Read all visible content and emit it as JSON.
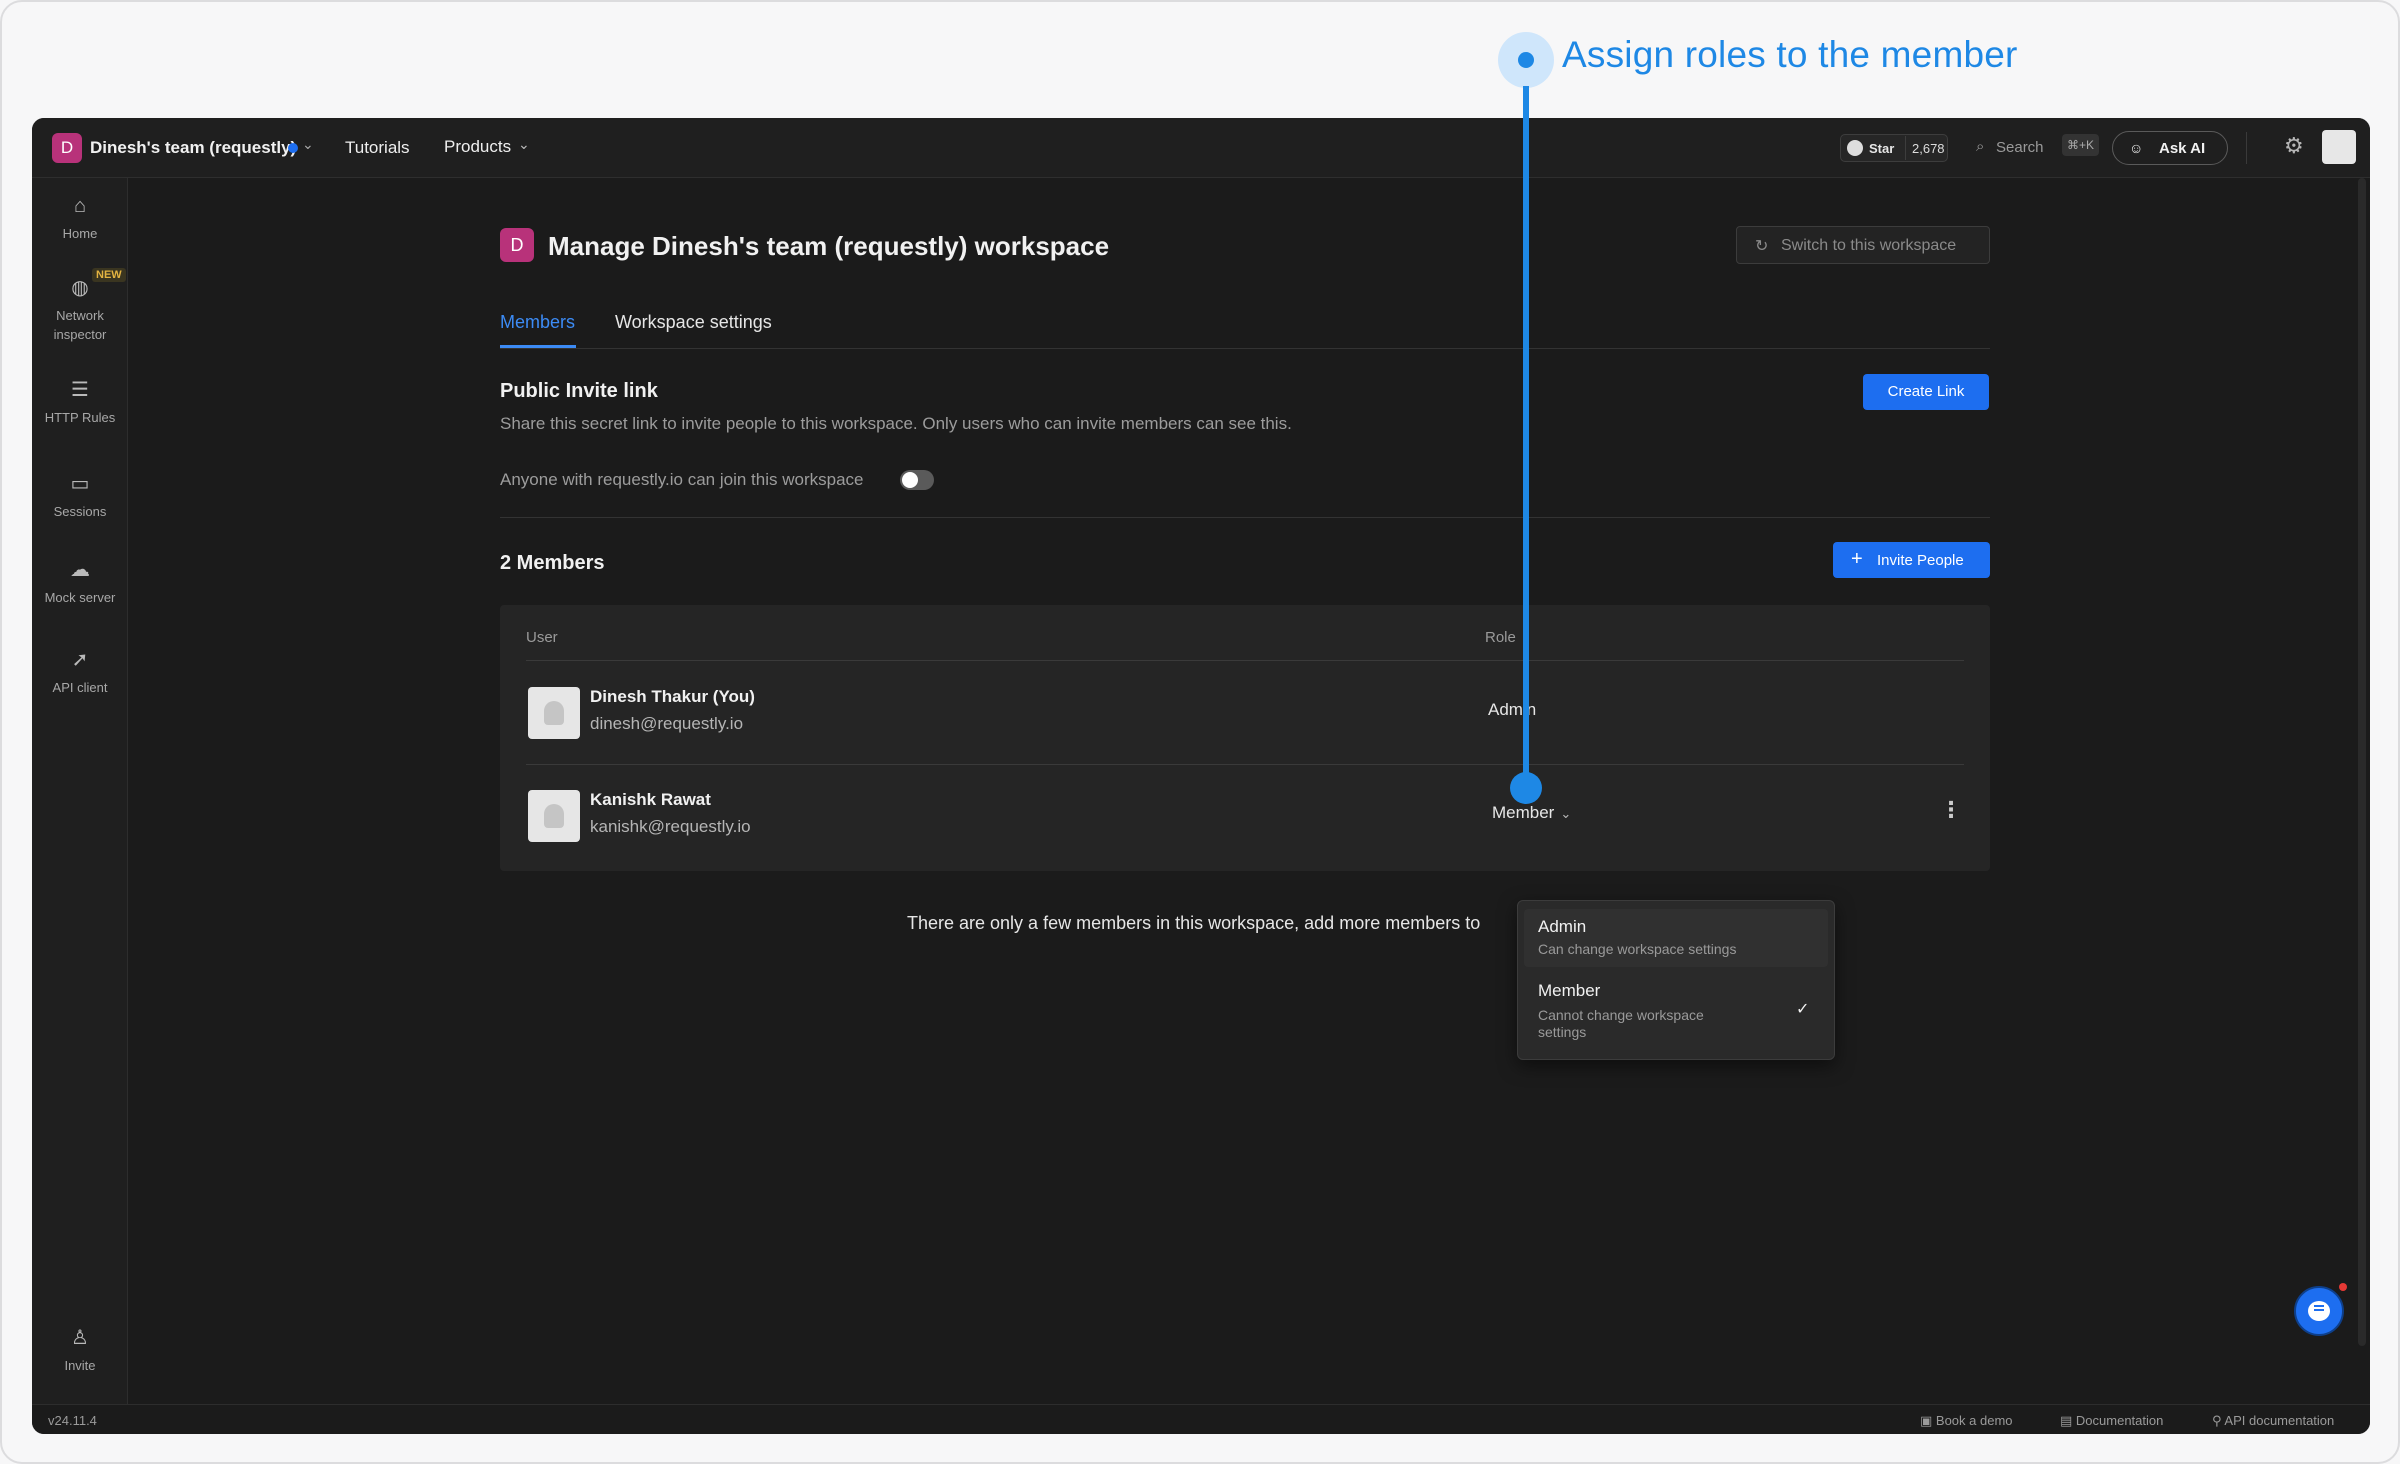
{
  "callout": {
    "text": "Assign roles to the member",
    "color": "#1e88e5"
  },
  "topbar": {
    "workspace_initial": "D",
    "workspace_name": "Dinesh's team (requestly)",
    "nav": {
      "tutorials": "Tutorials",
      "products": "Products"
    },
    "github": {
      "label": "Star",
      "count": "2,678"
    },
    "search": {
      "label": "Search",
      "shortcut": "⌘+K"
    },
    "ask_ai": "Ask AI"
  },
  "sidebar": {
    "items": [
      {
        "label": "Home",
        "icon": "home-icon"
      },
      {
        "label": "Network inspector",
        "icon": "globe-icon",
        "badge": "NEW"
      },
      {
        "label": "HTTP Rules",
        "icon": "sliders-icon"
      },
      {
        "label": "Sessions",
        "icon": "video-icon"
      },
      {
        "label": "Mock server",
        "icon": "cloud-icon"
      },
      {
        "label": "API client",
        "icon": "rocket-icon"
      }
    ],
    "invite": {
      "label": "Invite",
      "icon": "user-plus-icon"
    }
  },
  "page": {
    "initial": "D",
    "title": "Manage Dinesh's team (requestly) workspace",
    "switch_button": "Switch to this workspace",
    "tabs": [
      {
        "label": "Members",
        "active": true
      },
      {
        "label": "Workspace settings",
        "active": false
      }
    ],
    "invite_link": {
      "title": "Public Invite link",
      "description": "Share this secret link to invite people to this workspace. Only users who can invite members can see this.",
      "create_button": "Create Link",
      "anyone_text": "Anyone with requestly.io can join this workspace",
      "toggle_on": false
    },
    "members": {
      "count_label": "2 Members",
      "invite_button": "Invite People",
      "columns": {
        "user": "User",
        "role": "Role"
      },
      "rows": [
        {
          "name": "Dinesh Thakur (You)",
          "email": "dinesh@requestly.io",
          "role": "Admin"
        },
        {
          "name": "Kanishk Rawat",
          "email": "kanishk@requestly.io",
          "role": "Member"
        }
      ]
    },
    "empty_note": "There are only a few members in this workspace, add more members to"
  },
  "role_dropdown": {
    "options": [
      {
        "label": "Admin",
        "description": "Can change workspace settings",
        "selected": false
      },
      {
        "label": "Member",
        "description": "Cannot change workspace settings",
        "selected": true
      }
    ]
  },
  "footer": {
    "version": "v24.11.4",
    "links": [
      "Book a demo",
      "Documentation",
      "API documentation"
    ]
  },
  "colors": {
    "accent": "#1d6ef0",
    "workspace_badge": "#b8327a",
    "background": "#1b1b1b"
  }
}
